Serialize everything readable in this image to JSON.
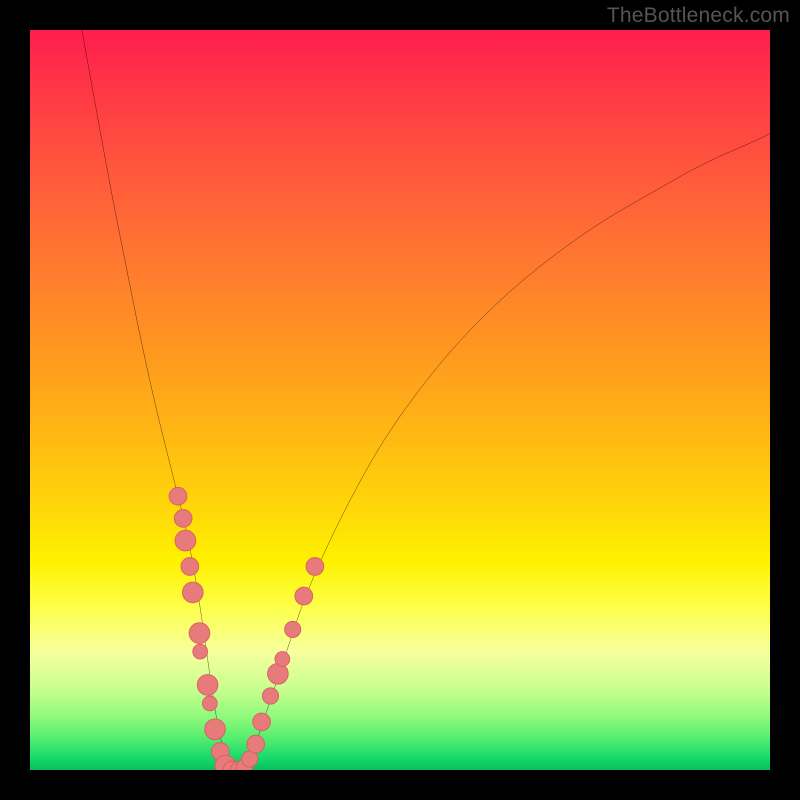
{
  "watermark": {
    "text": "TheBottleneck.com"
  },
  "colors": {
    "background": "#000000",
    "curve": "#000000",
    "marker_fill": "#e77a7a",
    "marker_stroke": "#d85f5f",
    "gradient_stops": [
      "#ff1d4d",
      "#ff3a44",
      "#ff5a3c",
      "#ff7a2f",
      "#ff991f",
      "#ffb912",
      "#ffd808",
      "#fff200",
      "#fdff4a",
      "#f6ff9d",
      "#c9ff8f",
      "#8cf97a",
      "#4eec6e",
      "#14d86a",
      "#0abf5e"
    ]
  },
  "chart_data": {
    "type": "line",
    "title": "",
    "xlabel": "",
    "ylabel": "",
    "xlim": [
      0,
      100
    ],
    "ylim": [
      0,
      100
    ],
    "grid": false,
    "legend": false,
    "series": [
      {
        "name": "bottleneck-curve",
        "x": [
          7,
          9,
          11,
          13,
          15,
          17,
          19,
          20,
          21,
          22,
          23,
          24,
          25,
          26,
          27,
          28,
          29,
          30,
          31,
          33,
          35,
          37,
          40,
          44,
          48,
          53,
          58,
          64,
          70,
          77,
          84,
          91,
          98,
          100
        ],
        "y": [
          100,
          89,
          78,
          68,
          58,
          49,
          41,
          37,
          33,
          28,
          22,
          15,
          8,
          3,
          0,
          0,
          0,
          2,
          5,
          11,
          17,
          23,
          30,
          38,
          45,
          52,
          58,
          64,
          69,
          74,
          78,
          82,
          85,
          86
        ]
      }
    ],
    "markers": [
      {
        "x": 20.0,
        "y": 37.0,
        "r": 1.2
      },
      {
        "x": 20.7,
        "y": 34.0,
        "r": 1.2
      },
      {
        "x": 21.0,
        "y": 31.0,
        "r": 1.4
      },
      {
        "x": 21.6,
        "y": 27.5,
        "r": 1.2
      },
      {
        "x": 22.0,
        "y": 24.0,
        "r": 1.4
      },
      {
        "x": 22.9,
        "y": 18.5,
        "r": 1.4
      },
      {
        "x": 23.0,
        "y": 16.0,
        "r": 1.0
      },
      {
        "x": 24.0,
        "y": 11.5,
        "r": 1.4
      },
      {
        "x": 24.3,
        "y": 9.0,
        "r": 1.0
      },
      {
        "x": 25.0,
        "y": 5.5,
        "r": 1.4
      },
      {
        "x": 25.7,
        "y": 2.5,
        "r": 1.2
      },
      {
        "x": 26.4,
        "y": 0.6,
        "r": 1.4
      },
      {
        "x": 27.3,
        "y": 0.0,
        "r": 1.2
      },
      {
        "x": 28.3,
        "y": 0.0,
        "r": 1.2
      },
      {
        "x": 29.0,
        "y": 0.4,
        "r": 1.1
      },
      {
        "x": 29.7,
        "y": 1.5,
        "r": 1.1
      },
      {
        "x": 30.5,
        "y": 3.5,
        "r": 1.2
      },
      {
        "x": 31.3,
        "y": 6.5,
        "r": 1.2
      },
      {
        "x": 32.5,
        "y": 10.0,
        "r": 1.1
      },
      {
        "x": 33.5,
        "y": 13.0,
        "r": 1.4
      },
      {
        "x": 34.1,
        "y": 15.0,
        "r": 1.0
      },
      {
        "x": 35.5,
        "y": 19.0,
        "r": 1.1
      },
      {
        "x": 37.0,
        "y": 23.5,
        "r": 1.2
      },
      {
        "x": 38.5,
        "y": 27.5,
        "r": 1.2
      }
    ],
    "annotations": []
  }
}
